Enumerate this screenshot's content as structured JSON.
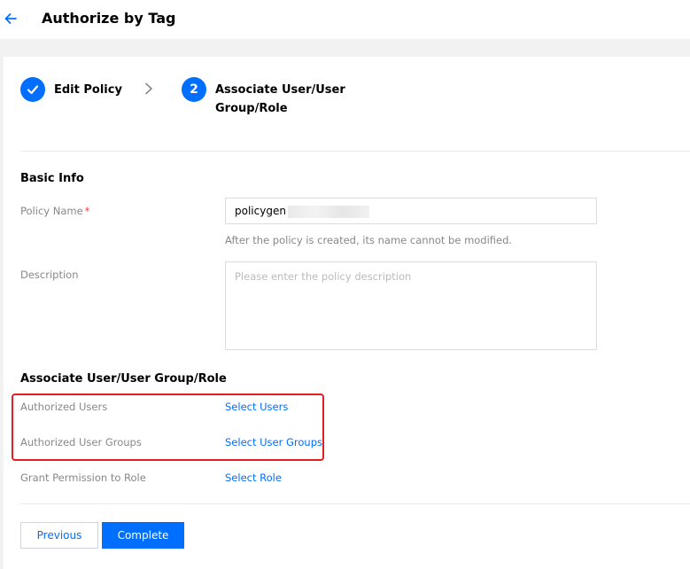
{
  "header": {
    "title": "Authorize by Tag",
    "back_icon": "arrow-left-icon"
  },
  "steps": [
    {
      "label": "Edit Policy",
      "state": "completed",
      "icon": "check-icon"
    },
    {
      "number": "2",
      "label_line1": "Associate User/User",
      "label_line2": "Group/Role",
      "state": "active"
    }
  ],
  "basic_info": {
    "title": "Basic Info",
    "policy_name_label": "Policy Name",
    "required_mark": "*",
    "policy_name_value": "policygen",
    "policy_name_help": "After the policy is created, its name cannot be modified.",
    "description_label": "Description",
    "description_placeholder": "Please enter the policy description"
  },
  "associate": {
    "title": "Associate User/User Group/Role",
    "users_label": "Authorized Users",
    "users_link": "Select Users",
    "groups_label": "Authorized User Groups",
    "groups_link": "Select User Groups",
    "role_label": "Grant Permission to Role",
    "role_link": "Select Role"
  },
  "footer": {
    "previous_label": "Previous",
    "complete_label": "Complete"
  },
  "colors": {
    "accent": "#006eff",
    "highlight": "#e02020",
    "required": "#e54545"
  }
}
